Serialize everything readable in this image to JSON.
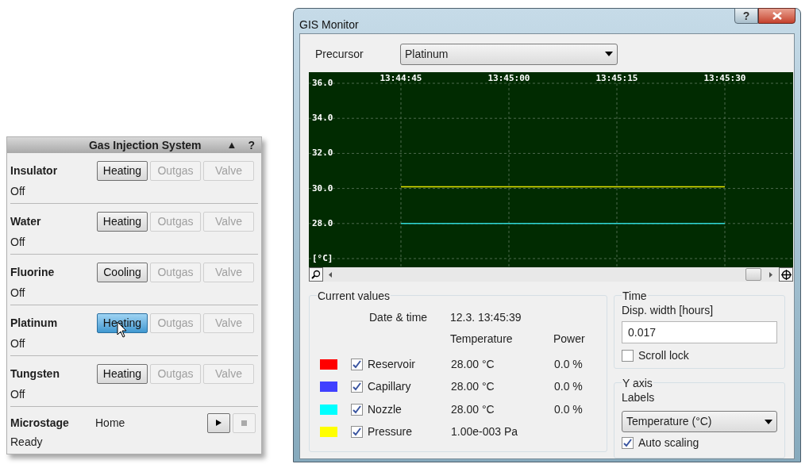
{
  "gas_injection_panel": {
    "title": "Gas Injection System",
    "collapse_glyph": "▲",
    "help_glyph": "?",
    "precursors": [
      {
        "name": "Insulator",
        "status": "Off",
        "buttons": [
          {
            "label": "Heating",
            "disabled": false,
            "highlighted": false
          },
          {
            "label": "Outgas",
            "disabled": true,
            "highlighted": false
          },
          {
            "label": "Valve",
            "disabled": true,
            "highlighted": false
          }
        ]
      },
      {
        "name": "Water",
        "status": "Off",
        "buttons": [
          {
            "label": "Heating",
            "disabled": false,
            "highlighted": false
          },
          {
            "label": "Outgas",
            "disabled": true,
            "highlighted": false
          },
          {
            "label": "Valve",
            "disabled": true,
            "highlighted": false
          }
        ]
      },
      {
        "name": "Fluorine",
        "status": "Off",
        "buttons": [
          {
            "label": "Cooling",
            "disabled": false,
            "highlighted": false
          },
          {
            "label": "Outgas",
            "disabled": true,
            "highlighted": false
          },
          {
            "label": "Valve",
            "disabled": true,
            "highlighted": false
          }
        ]
      },
      {
        "name": "Platinum",
        "status": "Off",
        "buttons": [
          {
            "label": "Heating",
            "disabled": false,
            "highlighted": true
          },
          {
            "label": "Outgas",
            "disabled": true,
            "highlighted": false
          },
          {
            "label": "Valve",
            "disabled": true,
            "highlighted": false
          }
        ]
      },
      {
        "name": "Tungsten",
        "status": "Off",
        "buttons": [
          {
            "label": "Heating",
            "disabled": false,
            "highlighted": false
          },
          {
            "label": "Outgas",
            "disabled": true,
            "highlighted": false
          },
          {
            "label": "Valve",
            "disabled": true,
            "highlighted": false
          }
        ]
      }
    ],
    "microstage": {
      "name": "Microstage",
      "position": "Home",
      "status": "Ready",
      "play_disabled": false,
      "stop_disabled": true
    }
  },
  "monitor_window": {
    "title": "GIS Monitor",
    "help_glyph": "?",
    "precursor": {
      "label": "Precursor",
      "value": "Platinum"
    },
    "chart": {
      "chart_data": {
        "type": "line",
        "grid": true,
        "ylim": [
          26,
          36
        ],
        "categories": [
          "13:44:45",
          "13:45:00",
          "13:45:15",
          "13:45:30"
        ],
        "yticks": [
          {
            "value": 36,
            "label": "36.0"
          },
          {
            "value": 34,
            "label": "34.0"
          },
          {
            "value": 32,
            "label": "32.0"
          },
          {
            "value": 30,
            "label": "30.0"
          },
          {
            "value": 28,
            "label": "28.0"
          },
          {
            "value": 26,
            "label": "[°C]"
          }
        ],
        "series": [
          {
            "color": "#e6e600",
            "values": [
              30.1,
              30.1,
              30.1,
              30.1
            ]
          },
          {
            "color": "#30d8d8",
            "values": [
              28,
              28,
              28,
              28
            ]
          }
        ]
      }
    },
    "current_values": {
      "title": "Current values",
      "date_label": "Date & time",
      "date_value": "12.3. 13:45:39",
      "columns": [
        "Temperature",
        "Power"
      ],
      "channels": [
        {
          "name": "Reservoir",
          "color": "#ff0000",
          "checked": true,
          "temperature": "28.00 °C",
          "power": "0.0 %"
        },
        {
          "name": "Capillary",
          "color": "#4040ff",
          "checked": true,
          "temperature": "28.00 °C",
          "power": "0.0 %"
        },
        {
          "name": "Nozzle",
          "color": "#00ffff",
          "checked": true,
          "temperature": "28.00 °C",
          "power": "0.0 %"
        },
        {
          "name": "Pressure",
          "color": "#ffff00",
          "checked": true,
          "temperature": "1.00e-003 Pa"
        }
      ]
    },
    "time": {
      "title": "Time",
      "label": "Disp. width [hours]",
      "value": "0.017",
      "scroll_lock": {
        "label": "Scroll lock",
        "checked": false
      }
    },
    "y_axis": {
      "title": "Y axis",
      "label": "Labels",
      "value": "Temperature (°C)",
      "auto_scaling": {
        "label": "Auto scaling",
        "checked": true
      }
    }
  }
}
